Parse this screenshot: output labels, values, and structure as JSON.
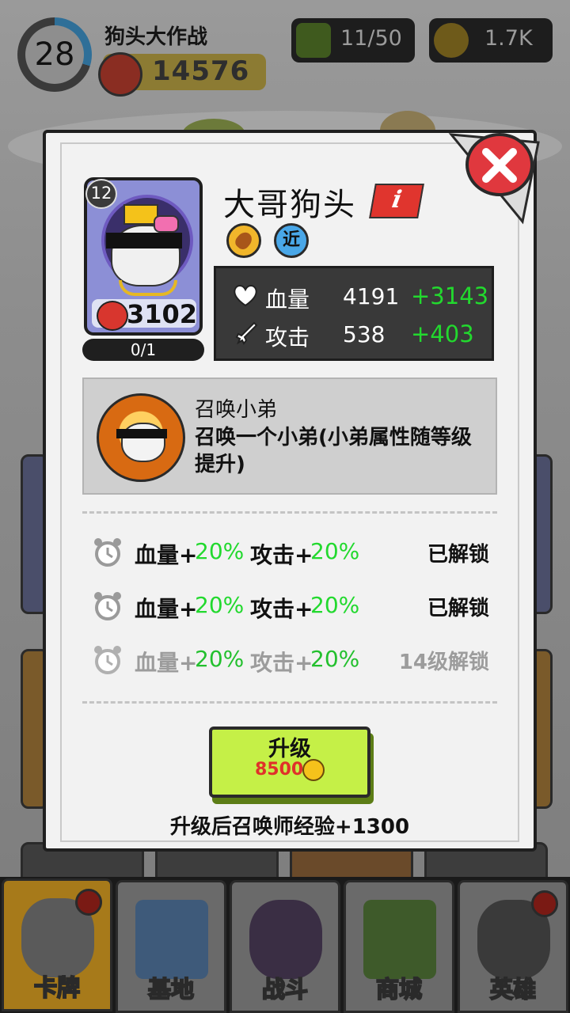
{
  "hud": {
    "level": "28",
    "player_name": "狗头大作战",
    "power": "14576",
    "energy": "11/50",
    "gold": "1.7K"
  },
  "hero": {
    "level": "12",
    "name": "大哥狗头",
    "info_label": "i",
    "range_tag": "近",
    "power": "3102",
    "shards": "0/1",
    "shard_progress": 0
  },
  "stats": {
    "hp_label": "血量",
    "hp_value": "4191",
    "hp_bonus": "+3143",
    "atk_label": "攻击",
    "atk_value": "538",
    "atk_bonus": "+403"
  },
  "skill": {
    "title": "召唤小弟",
    "description": "召唤一个小弟(小弟属性随等级提升)"
  },
  "unlocks": [
    {
      "hp_label": "血量+",
      "hp_value": "20%",
      "atk_label": "攻击+",
      "atk_value": "20%",
      "status": "已解锁"
    },
    {
      "hp_label": "血量+",
      "hp_value": "20%",
      "atk_label": "攻击+",
      "atk_value": "20%",
      "status": "已解锁"
    },
    {
      "hp_label": "血量+",
      "hp_value": "20%",
      "atk_label": "攻击+",
      "atk_value": "20%",
      "status": "14级解锁"
    }
  ],
  "upgrade": {
    "label": "升级",
    "cost": "8500",
    "note": "升级后召唤师经验+1300"
  },
  "nav": [
    {
      "label": "卡牌",
      "active": true,
      "badge": true
    },
    {
      "label": "基地",
      "active": false,
      "badge": false
    },
    {
      "label": "战斗",
      "active": false,
      "badge": false
    },
    {
      "label": "商城",
      "active": false,
      "badge": false
    },
    {
      "label": "英雄",
      "active": false,
      "badge": true
    }
  ],
  "colors": {
    "bonus_green": "#22d92e",
    "close_red": "#e0383e",
    "upgrade_lime": "#c5f047",
    "cost_red": "#e0312a"
  }
}
